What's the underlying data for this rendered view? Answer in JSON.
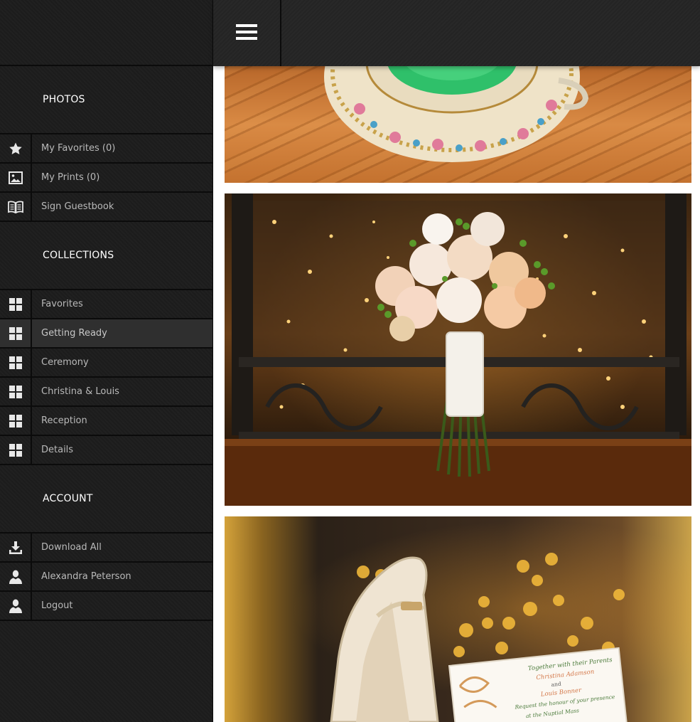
{
  "sidebar": {
    "sections": {
      "photos": "PHOTOS",
      "collections": "COLLECTIONS",
      "account": "ACCOUNT"
    },
    "photos_items": [
      {
        "label": "My Favorites (0)",
        "icon": "star-icon"
      },
      {
        "label": "My Prints (0)",
        "icon": "picture-icon"
      },
      {
        "label": "Sign Guestbook",
        "icon": "book-icon"
      }
    ],
    "collection_items": [
      {
        "label": "Favorites",
        "icon": "grid-icon"
      },
      {
        "label": "Getting Ready",
        "icon": "grid-icon",
        "active": true
      },
      {
        "label": "Ceremony",
        "icon": "grid-icon"
      },
      {
        "label": "Christina & Louis",
        "icon": "grid-icon"
      },
      {
        "label": "Reception",
        "icon": "grid-icon"
      },
      {
        "label": "Details",
        "icon": "grid-icon"
      }
    ],
    "account_items": [
      {
        "label": "Download All",
        "icon": "download-icon"
      },
      {
        "label": "Alexandra Peterson",
        "icon": "user-icon"
      },
      {
        "label": "Logout",
        "icon": "user-icon"
      }
    ]
  },
  "header": {
    "menu_icon": "hamburger-menu-icon"
  },
  "gallery": {
    "photos": [
      {
        "subject": "teacup-saucer"
      },
      {
        "subject": "bridal-bouquet"
      },
      {
        "subject": "wedding-shoes-invitation"
      }
    ],
    "invitation_text": [
      "Together with their Parents",
      "Christina Adamson",
      "and",
      "Louis Bonner",
      "Request the honour of your presence",
      "at the Nuptial Mass"
    ]
  },
  "colors": {
    "sidebar_bg": "#1d1d1d",
    "header_bg": "#252525",
    "active_item_bg": "#2f2f2f",
    "label_text": "#b9b9b9",
    "heading_text": "#ffffff"
  }
}
